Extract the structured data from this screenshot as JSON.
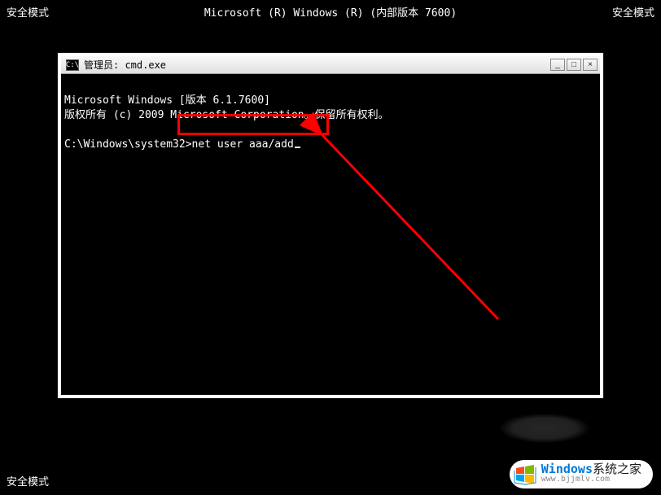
{
  "desktop": {
    "safe_mode_tl": "安全模式",
    "center_label": "Microsoft (R) Windows (R)  (内部版本 7600)",
    "safe_mode_tr": "安全模式",
    "safe_mode_bl": "安全模式"
  },
  "window": {
    "title_icon": "C:\\",
    "title": "管理员: cmd.exe",
    "controls": {
      "min": "_",
      "max": "□",
      "close": "×"
    }
  },
  "cmd": {
    "line1": "Microsoft Windows [版本 6.1.7600]",
    "line2": "版权所有 (c) 2009 Microsoft Corporation。保留所有权利。",
    "prompt": "C:\\Windows\\system32>",
    "command": "net user aaa/add"
  },
  "watermark": {
    "brand_prefix": "Windows",
    "brand_suffix": "系统之家",
    "url": "www.bjjmlv.com"
  }
}
